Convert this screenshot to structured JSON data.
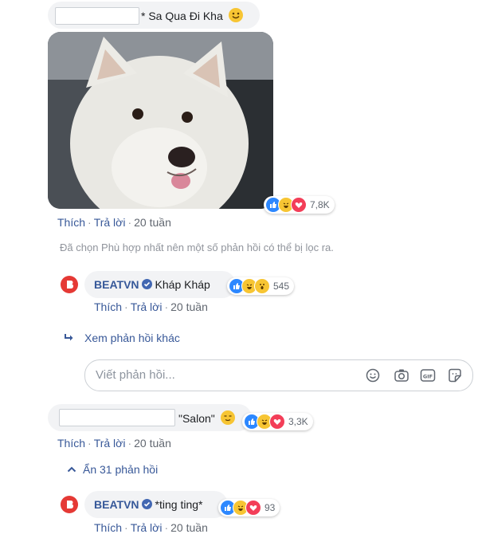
{
  "c1": {
    "text": "* Sa Qua Đi Kha",
    "reactions": "7,8K",
    "like": "Thích",
    "reply": "Trả lời",
    "time": "20 tuần"
  },
  "filter_note": "Đã chọn Phù hợp nhất nên một số phản hồi có thể bị lọc ra.",
  "r1": {
    "name": "BEATVN",
    "text": "Kháp Kháp",
    "reactions": "545",
    "like": "Thích",
    "reply": "Trả lời",
    "time": "20 tuần"
  },
  "more_replies": "Xem phản hồi khác",
  "reply_box": {
    "placeholder": "Viết phản hồi..."
  },
  "c2": {
    "text": "\"Salon\"",
    "reactions": "3,3K",
    "like": "Thích",
    "reply": "Trả lời",
    "time": "20 tuần"
  },
  "hide_replies": "Ẩn 31 phản hồi",
  "r2": {
    "name": "BEATVN",
    "text": "*ting ting*",
    "reactions": "93",
    "like": "Thích",
    "reply": "Trả lời",
    "time": "20 tuần"
  },
  "colors": {
    "like": "#2d88ff",
    "haha": "#f7c533",
    "love": "#f33e58",
    "link": "#385898",
    "brand": "#e53935"
  },
  "icons": [
    "like-reaction-icon",
    "haha-reaction-icon",
    "love-reaction-icon",
    "wow-reaction-icon",
    "smiley-emoji-icon",
    "verified-badge-icon",
    "reply-arrow-icon",
    "chevron-up-icon",
    "emoji-icon",
    "camera-icon",
    "gif-icon",
    "sticker-icon"
  ]
}
